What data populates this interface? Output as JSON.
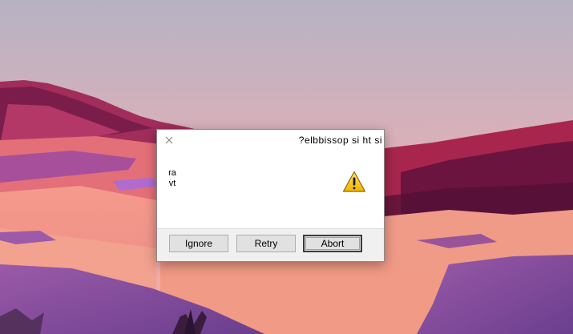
{
  "dialog": {
    "title": "?elbbissop si ht si",
    "message": "ravt",
    "icon": "warning-icon",
    "buttons": [
      {
        "label": "Ignore"
      },
      {
        "label": "Retry"
      },
      {
        "label": "Abort"
      }
    ]
  },
  "colors": {
    "sky_top": "#b6b2c3",
    "sky_bottom": "#f2a7a8",
    "dune_pink": "#f48f88",
    "dune_purple": "#8a4f9e",
    "mountain_dark": "#7a1d4b",
    "dialog_bg": "#ffffff",
    "button_bar_bg": "#f0f0f0"
  }
}
